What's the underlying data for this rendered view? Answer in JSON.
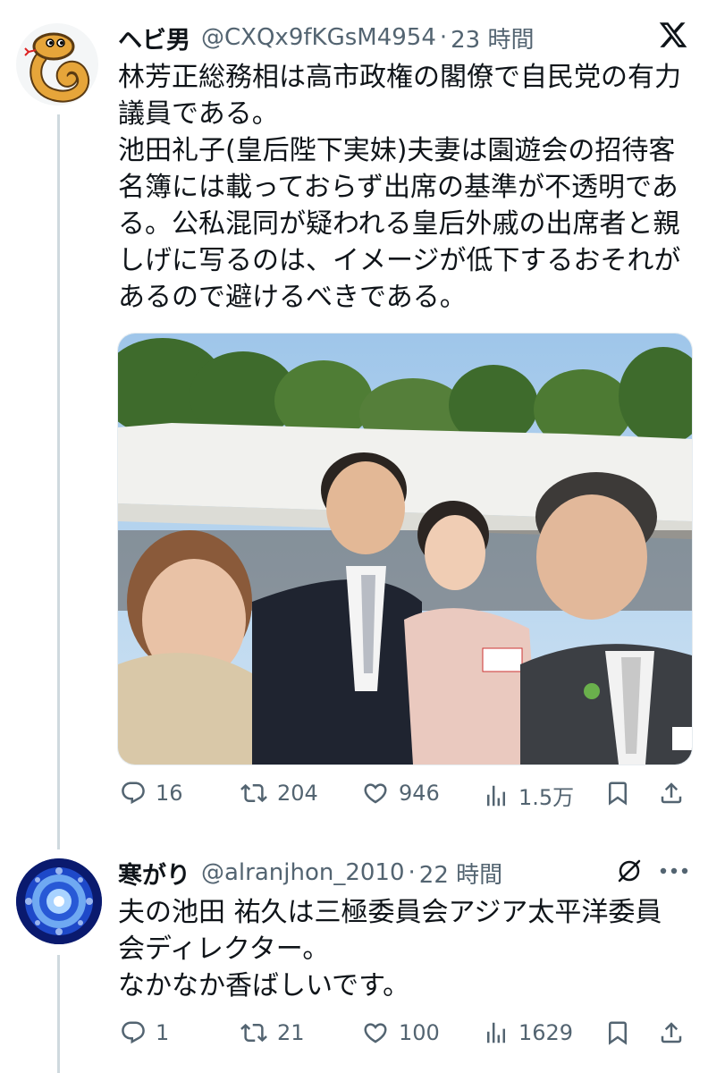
{
  "tweet1": {
    "name": "ヘビ男",
    "handle": "@CXQx9fKGsM4954",
    "separator": "·",
    "time": "23 時間",
    "text": "林芳正総務相は高市政権の閣僚で自民党の有力\n議員である。\n池田礼子(皇后陛下実妹)夫妻は園遊会の招待客\n名簿には載っておらず出席の基準が不透明であ\nる。公私混同が疑われる皇后外戚の出席者と親\nしげに写るのは、イメージが低下するおそれが\nあるので避けるべきである。",
    "stats": {
      "replies": "16",
      "reposts": "204",
      "likes": "946",
      "views": "1.5万"
    }
  },
  "tweet2": {
    "name": "寒がり",
    "handle": "@alranjhon_2010",
    "separator": "·",
    "time": "22 時間",
    "text": "夫の池田 祐久は三極委員会アジア太平洋委員\n会ディレクター。\nなかなか香ばしいです。",
    "stats": {
      "replies": "1",
      "reposts": "21",
      "likes": "100",
      "views": "1629"
    }
  },
  "colors": {
    "text": "#0f1419",
    "secondary": "#536471",
    "thread_line": "#cfd9de",
    "grok_icon": "#0f1419"
  },
  "icons": [
    "x-logo-icon",
    "reply-icon",
    "repost-icon",
    "like-icon",
    "views-icon",
    "bookmark-icon",
    "share-icon",
    "grok-icon",
    "more-icon"
  ]
}
